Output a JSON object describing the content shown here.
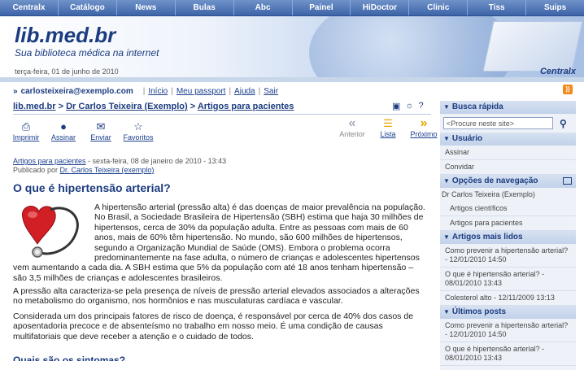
{
  "nav": [
    "Centralx",
    "Catálogo",
    "News",
    "Bulas",
    "Abc",
    "Painel",
    "HiDoctor",
    "Clinic",
    "Tiss",
    "Suips"
  ],
  "banner": {
    "title": "lib.med.br",
    "tagline": "Sua biblioteca médica na internet",
    "date": "terça-feira, 01 de junho de 2010",
    "brand": "Centralx"
  },
  "user": {
    "email": "carlosteixeira@exemplo.com",
    "links": [
      "Início",
      "Meu passport",
      "Ajuda",
      "Sair"
    ]
  },
  "breadcrumb": [
    "lib.med.br",
    "Dr Carlos Teixeira (Exemplo)",
    "Artigos para pacientes"
  ],
  "actions": [
    "Imprimir",
    "Assinar",
    "Enviar",
    "Favoritos"
  ],
  "pager": {
    "prev": "Anterior",
    "list": "Lista",
    "next": "Próximo"
  },
  "meta": {
    "category": "Artigos para pacientes",
    "date": " - sexta-feira, 08 de janeiro de 2010 - 13:43",
    "published_by": "Publicado por ",
    "author": "Dr. Carlos Teixeira (exemplo)"
  },
  "article": {
    "title": "O que é hipertensão arterial?",
    "p1": "A hipertensão arterial (pressão alta) é das doenças de maior prevalência na população. No Brasil, a Sociedade Brasileira de Hipertensão (SBH) estima que haja 30 milhões de hipertensos, cerca de 30% da população adulta. Entre as pessoas com mais de 60 anos, mais de 60% têm hipertensão. No mundo, são 600 milhões de hipertensos, segundo a Organização Mundial de Saúde (OMS). Embora o problema ocorra predominantemente na fase adulta, o número de crianças e adolescentes hipertensos vem aumentando a cada dia. A SBH estima que 5% da população com até 18 anos tenham hipertensão – são 3,5 milhões de crianças e adolescentes brasileiros.",
    "p2": "A pressão alta caracteriza-se pela presença de níveis de pressão arterial elevados associados a alterações no metabolismo do organismo, nos hormônios e nas musculaturas cardíaca e vascular.",
    "p3": "Considerada um dos principais fatores de risco de doença, é responsável por cerca de 40% dos casos de aposentadoria precoce e de absenteísmo no trabalho em nosso meio. É uma condição de causas multifatoriais que deve receber a atenção e o cuidado de todos.",
    "cutoff": "Quais são os sintomas?"
  },
  "sidebar": {
    "search_title": "Busca rápida",
    "search_placeholder": "<Procure neste site>",
    "user_title": "Usuário",
    "user_items": [
      "Assinar",
      "Convidar"
    ],
    "nav_title": "Opções de navegação",
    "nav_root": "Dr Carlos Teixeira (Exemplo)",
    "nav_items": [
      "Artigos científicos",
      "Artigos para pacientes"
    ],
    "most_read_title": "Artigos mais lidos",
    "most_read": [
      "Como prevenir a hipertensão arterial? - 12/01/2010 14:50",
      "O que é hipertensão arterial? - 08/01/2010 13:43",
      "Colesterol alto - 12/11/2009 13:13"
    ],
    "latest_title": "Últimos posts",
    "latest": [
      "Como prevenir a hipertensão arterial? - 12/01/2010 14:50",
      "O que é hipertensão arterial? - 08/01/2010 13:43"
    ]
  }
}
